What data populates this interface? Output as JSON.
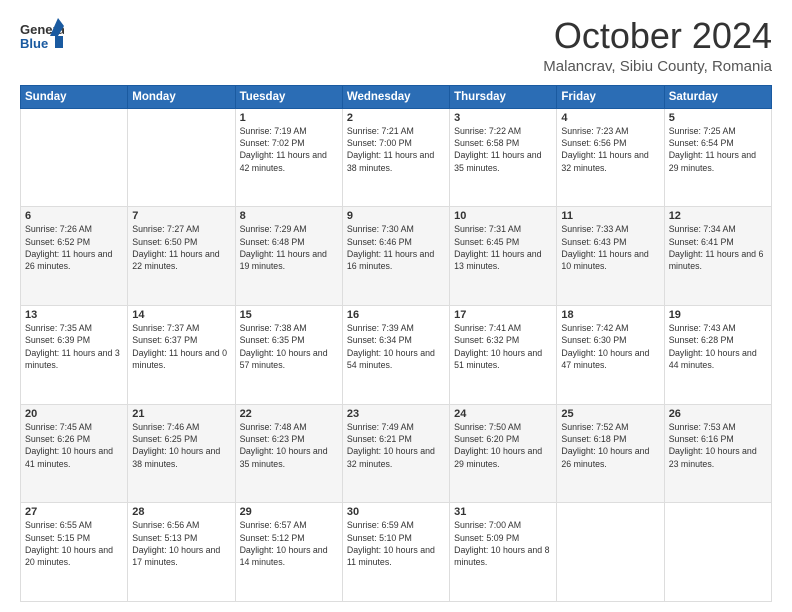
{
  "header": {
    "logo_general": "General",
    "logo_blue": "Blue",
    "month_title": "October 2024",
    "location": "Malancrav, Sibiu County, Romania"
  },
  "calendar": {
    "days_of_week": [
      "Sunday",
      "Monday",
      "Tuesday",
      "Wednesday",
      "Thursday",
      "Friday",
      "Saturday"
    ],
    "weeks": [
      [
        {
          "day": "",
          "content": ""
        },
        {
          "day": "",
          "content": ""
        },
        {
          "day": "1",
          "content": "Sunrise: 7:19 AM\nSunset: 7:02 PM\nDaylight: 11 hours and 42 minutes."
        },
        {
          "day": "2",
          "content": "Sunrise: 7:21 AM\nSunset: 7:00 PM\nDaylight: 11 hours and 38 minutes."
        },
        {
          "day": "3",
          "content": "Sunrise: 7:22 AM\nSunset: 6:58 PM\nDaylight: 11 hours and 35 minutes."
        },
        {
          "day": "4",
          "content": "Sunrise: 7:23 AM\nSunset: 6:56 PM\nDaylight: 11 hours and 32 minutes."
        },
        {
          "day": "5",
          "content": "Sunrise: 7:25 AM\nSunset: 6:54 PM\nDaylight: 11 hours and 29 minutes."
        }
      ],
      [
        {
          "day": "6",
          "content": "Sunrise: 7:26 AM\nSunset: 6:52 PM\nDaylight: 11 hours and 26 minutes."
        },
        {
          "day": "7",
          "content": "Sunrise: 7:27 AM\nSunset: 6:50 PM\nDaylight: 11 hours and 22 minutes."
        },
        {
          "day": "8",
          "content": "Sunrise: 7:29 AM\nSunset: 6:48 PM\nDaylight: 11 hours and 19 minutes."
        },
        {
          "day": "9",
          "content": "Sunrise: 7:30 AM\nSunset: 6:46 PM\nDaylight: 11 hours and 16 minutes."
        },
        {
          "day": "10",
          "content": "Sunrise: 7:31 AM\nSunset: 6:45 PM\nDaylight: 11 hours and 13 minutes."
        },
        {
          "day": "11",
          "content": "Sunrise: 7:33 AM\nSunset: 6:43 PM\nDaylight: 11 hours and 10 minutes."
        },
        {
          "day": "12",
          "content": "Sunrise: 7:34 AM\nSunset: 6:41 PM\nDaylight: 11 hours and 6 minutes."
        }
      ],
      [
        {
          "day": "13",
          "content": "Sunrise: 7:35 AM\nSunset: 6:39 PM\nDaylight: 11 hours and 3 minutes."
        },
        {
          "day": "14",
          "content": "Sunrise: 7:37 AM\nSunset: 6:37 PM\nDaylight: 11 hours and 0 minutes."
        },
        {
          "day": "15",
          "content": "Sunrise: 7:38 AM\nSunset: 6:35 PM\nDaylight: 10 hours and 57 minutes."
        },
        {
          "day": "16",
          "content": "Sunrise: 7:39 AM\nSunset: 6:34 PM\nDaylight: 10 hours and 54 minutes."
        },
        {
          "day": "17",
          "content": "Sunrise: 7:41 AM\nSunset: 6:32 PM\nDaylight: 10 hours and 51 minutes."
        },
        {
          "day": "18",
          "content": "Sunrise: 7:42 AM\nSunset: 6:30 PM\nDaylight: 10 hours and 47 minutes."
        },
        {
          "day": "19",
          "content": "Sunrise: 7:43 AM\nSunset: 6:28 PM\nDaylight: 10 hours and 44 minutes."
        }
      ],
      [
        {
          "day": "20",
          "content": "Sunrise: 7:45 AM\nSunset: 6:26 PM\nDaylight: 10 hours and 41 minutes."
        },
        {
          "day": "21",
          "content": "Sunrise: 7:46 AM\nSunset: 6:25 PM\nDaylight: 10 hours and 38 minutes."
        },
        {
          "day": "22",
          "content": "Sunrise: 7:48 AM\nSunset: 6:23 PM\nDaylight: 10 hours and 35 minutes."
        },
        {
          "day": "23",
          "content": "Sunrise: 7:49 AM\nSunset: 6:21 PM\nDaylight: 10 hours and 32 minutes."
        },
        {
          "day": "24",
          "content": "Sunrise: 7:50 AM\nSunset: 6:20 PM\nDaylight: 10 hours and 29 minutes."
        },
        {
          "day": "25",
          "content": "Sunrise: 7:52 AM\nSunset: 6:18 PM\nDaylight: 10 hours and 26 minutes."
        },
        {
          "day": "26",
          "content": "Sunrise: 7:53 AM\nSunset: 6:16 PM\nDaylight: 10 hours and 23 minutes."
        }
      ],
      [
        {
          "day": "27",
          "content": "Sunrise: 6:55 AM\nSunset: 5:15 PM\nDaylight: 10 hours and 20 minutes."
        },
        {
          "day": "28",
          "content": "Sunrise: 6:56 AM\nSunset: 5:13 PM\nDaylight: 10 hours and 17 minutes."
        },
        {
          "day": "29",
          "content": "Sunrise: 6:57 AM\nSunset: 5:12 PM\nDaylight: 10 hours and 14 minutes."
        },
        {
          "day": "30",
          "content": "Sunrise: 6:59 AM\nSunset: 5:10 PM\nDaylight: 10 hours and 11 minutes."
        },
        {
          "day": "31",
          "content": "Sunrise: 7:00 AM\nSunset: 5:09 PM\nDaylight: 10 hours and 8 minutes."
        },
        {
          "day": "",
          "content": ""
        },
        {
          "day": "",
          "content": ""
        }
      ]
    ]
  }
}
